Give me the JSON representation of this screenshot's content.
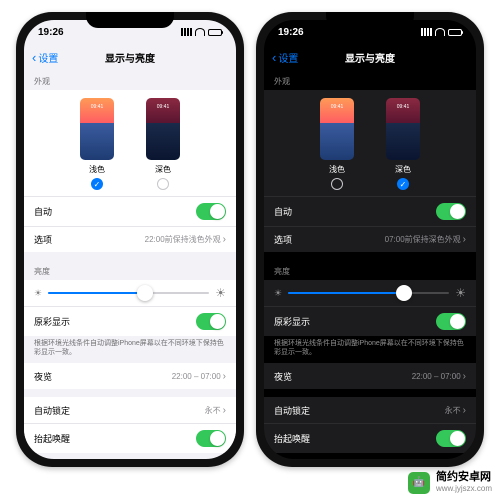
{
  "status": {
    "time": "19:26"
  },
  "nav": {
    "back": "设置",
    "title": "显示与亮度"
  },
  "sections": {
    "appearance_header": "外观",
    "light_label": "浅色",
    "dark_label": "深色",
    "auto_label": "自动",
    "options_label": "选项",
    "options_light_detail": "22:00前保持浅色外观",
    "options_dark_detail": "07:00前保持深色外观",
    "brightness_header": "亮度",
    "truetone_label": "原彩显示",
    "truetone_footer": "根据环境光线条件自动调整iPhone屏幕以在不同环境下保持色彩显示一致。",
    "nightshift_label": "夜览",
    "nightshift_detail": "22:00 – 07:00",
    "autolock_label": "自动锁定",
    "autolock_detail": "永不",
    "raise_label": "抬起唤醒"
  },
  "light_phone": {
    "brightness_pct": 60
  },
  "dark_phone": {
    "brightness_pct": 72
  },
  "watermark": {
    "name": "简约安卓网",
    "url": "www.jyjszx.com"
  }
}
